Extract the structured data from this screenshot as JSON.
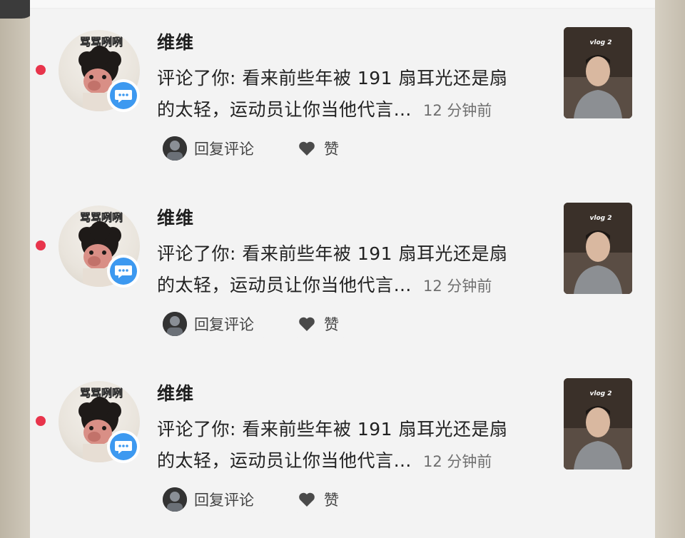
{
  "notifications": [
    {
      "username": "维维",
      "comment_line1": "评论了你: 看来前些年被 191 扇耳光还是扇",
      "comment_line2": "的太轻，运动员让你当他代言…",
      "time": "12 分钟前",
      "reply_label": "回复评论",
      "like_label": "赞",
      "unread": true
    },
    {
      "username": "维维",
      "comment_line1": "评论了你: 看来前些年被 191 扇耳光还是扇",
      "comment_line2": "的太轻，运动员让你当他代言…",
      "time": "12 分钟前",
      "reply_label": "回复评论",
      "like_label": "赞",
      "unread": true
    },
    {
      "username": "维维",
      "comment_line1": "评论了你: 看来前些年被 191 扇耳光还是扇",
      "comment_line2": "的太轻，运动员让你当他代言…",
      "time": "12 分钟前",
      "reply_label": "回复评论",
      "like_label": "赞",
      "unread": true
    }
  ],
  "avatar_caption": "骂骂咧咧",
  "thumbnail_caption": "vlog 2",
  "colors": {
    "unread_dot": "#e8344b",
    "comment_badge": "#3d99f0",
    "background": "#f3f3f3"
  },
  "icons": {
    "badge": "comment-bubble-icon",
    "like": "heart-icon"
  }
}
